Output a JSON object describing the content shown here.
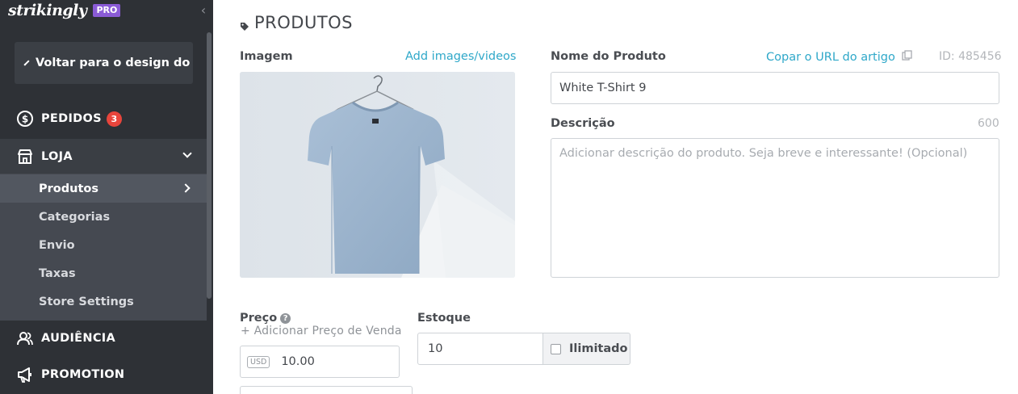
{
  "brand": {
    "name": "strikingly",
    "plan_badge": "PRO"
  },
  "sidebar": {
    "back_label": "Voltar para o design do site",
    "orders": {
      "label": "PEDIDOS",
      "count": "3"
    },
    "store": {
      "label": "LOJA"
    },
    "store_items": [
      {
        "label": "Produtos",
        "active": true
      },
      {
        "label": "Categorias"
      },
      {
        "label": "Envio"
      },
      {
        "label": "Taxas"
      },
      {
        "label": "Store Settings"
      }
    ],
    "audience": {
      "label": "AUDIÊNCIA"
    },
    "promotion": {
      "label": "PROMOTION"
    }
  },
  "main": {
    "title": "PRODUTOS",
    "image": {
      "label": "Imagem",
      "add_link": "Add images/videos",
      "icon": "t-shirt-photo"
    },
    "product_name": {
      "label": "Nome do Produto",
      "copy_link": "Copar o URL do artigo",
      "id_text": "ID: 485456",
      "value": "White T-Shirt 9"
    },
    "description": {
      "label": "Descrição",
      "char_limit": "600",
      "placeholder": "Adicionar descrição do produto. Seja breve e interessante! (Opcional)",
      "value": ""
    },
    "price": {
      "label": "Preço",
      "add_sale_price": "+ Adicionar Preço de Venda",
      "currency": "USD",
      "value": "10.00"
    },
    "stock": {
      "label": "Estoque",
      "value": "10",
      "unlimited_label": "Ilimitado",
      "unlimited_checked": false
    }
  },
  "colors": {
    "sidebar_bg": "#2e3136",
    "submenu_bg": "#454951",
    "accent_link": "#2fa8c9",
    "badge_red": "#e8453c",
    "pro_purple": "#8a5bd6"
  }
}
